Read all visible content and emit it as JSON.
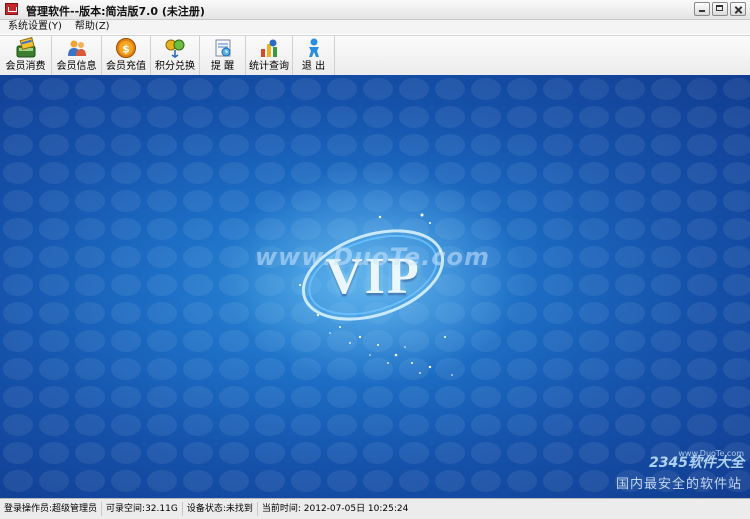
{
  "window": {
    "title": "管理软件--版本:简洁版7.0 (未注册)"
  },
  "menubar": {
    "items": [
      {
        "label": "系统设置(Y)"
      },
      {
        "label": "帮助(Z)"
      }
    ]
  },
  "toolbar": {
    "items": [
      {
        "label": "会员消费",
        "icon": "card-terminal-icon"
      },
      {
        "label": "会员信息",
        "icon": "users-icon"
      },
      {
        "label": "会员充值",
        "icon": "coin-icon"
      },
      {
        "label": "积分兑换",
        "icon": "exchange-icon"
      },
      {
        "label": "提 醒",
        "icon": "reminder-icon"
      },
      {
        "label": "统计查询",
        "icon": "statistics-icon"
      },
      {
        "label": "退 出",
        "icon": "exit-icon"
      }
    ]
  },
  "main": {
    "vip_text": "VIP",
    "watermark_center": "www.DuoTe.com",
    "watermark_brand": "2345软件大全",
    "watermark_url": "www.DuoTe.com",
    "watermark_sub": "国内最安全的软件站"
  },
  "statusbar": {
    "operator": "登录操作员:超级管理员",
    "space": "可录空间:32.11G",
    "device": "设备状态:未找到",
    "time": "当前时间: 2012-07-05日 10:25:24"
  },
  "colors": {
    "background_dark": "#113c90",
    "background_light": "#2f8fd9"
  }
}
